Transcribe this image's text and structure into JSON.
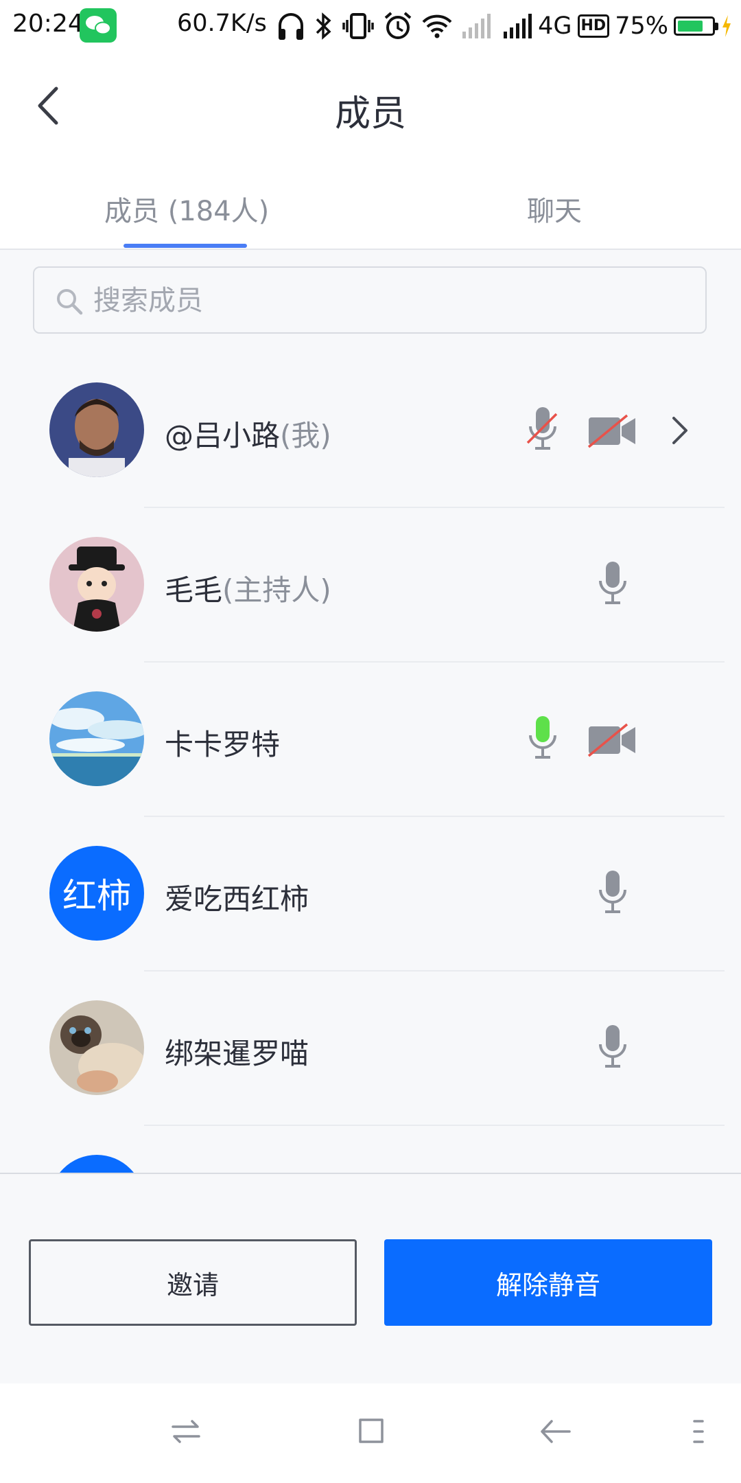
{
  "status_bar": {
    "time": "20:24",
    "speed": "60.7K/s",
    "network": "4G",
    "hd": "HD",
    "battery": "75%",
    "battery_level": 0.75,
    "icons": [
      "wechat-icon",
      "headphones-icon",
      "bluetooth-icon",
      "vibrate-icon",
      "alarm-icon",
      "wifi-icon",
      "signal-icon",
      "signal-icon",
      "hd-icon",
      "battery-icon",
      "charging-icon"
    ]
  },
  "header": {
    "title": "成员",
    "back_icon": "chevron-left-icon"
  },
  "tabs": [
    {
      "label": "成员 (184人)",
      "active": true
    },
    {
      "label": "聊天",
      "active": false
    }
  ],
  "search": {
    "placeholder": "搜索成员",
    "value": ""
  },
  "members": [
    {
      "name": "@吕小路",
      "suffix": "(我)",
      "avatar": "photo-portrait",
      "mic": "muted",
      "camera": "off",
      "has_detail": true
    },
    {
      "name": "毛毛",
      "suffix": "(主持人)",
      "avatar": "photo-cartoon-character",
      "mic": "idle",
      "camera": "none",
      "has_detail": false
    },
    {
      "name": "卡卡罗特",
      "suffix": "",
      "avatar": "photo-sky-ocean",
      "mic": "speaking",
      "camera": "off",
      "has_detail": false
    },
    {
      "name": "爱吃西红柿",
      "suffix": "",
      "avatar_text": "红柿",
      "mic": "idle",
      "camera": "none",
      "has_detail": false
    },
    {
      "name": "绑架暹罗喵",
      "suffix": "",
      "avatar": "photo-siamese-cat",
      "mic": "idle",
      "camera": "none",
      "has_detail": false
    }
  ],
  "actions": {
    "invite": "邀请",
    "unmute": "解除静音"
  },
  "colors": {
    "accent": "#0a6cff",
    "tab_indicator": "#4a7df5",
    "speaking": "#5ee04a",
    "muted_slash": "#e8524a",
    "icon_gray": "#8e929b"
  }
}
